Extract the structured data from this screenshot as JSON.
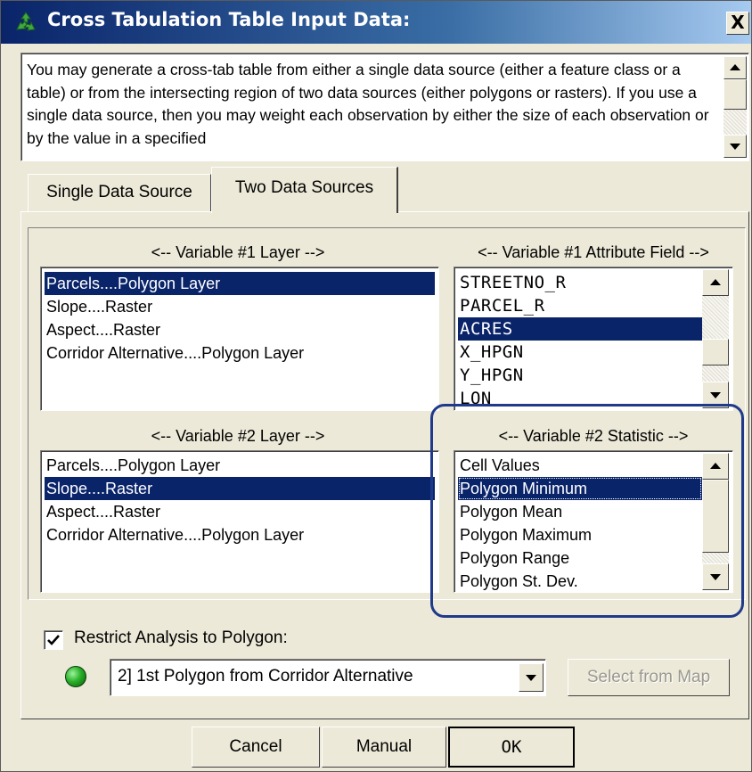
{
  "window": {
    "title": "Cross Tabulation Table Input Data:",
    "close_symbol": "X",
    "title_icon": "recycle-arrows-icon"
  },
  "description": {
    "text": "You may generate a cross-tab table from either a single data source (either a feature class or a table) or from the intersecting region of two data sources (either polygons or rasters).  If you use a single data source, then you may weight each observation by either the size of each observation or by the value in a specified"
  },
  "tabs": [
    {
      "label": "Single Data Source",
      "active": false
    },
    {
      "label": "Two Data Sources",
      "active": true
    }
  ],
  "variable1_layer": {
    "label": "<-- Variable #1 Layer -->",
    "items": [
      "Parcels....Polygon Layer",
      "Slope....Raster",
      "Aspect....Raster",
      "Corridor Alternative....Polygon Layer"
    ],
    "selected": "Parcels....Polygon Layer"
  },
  "variable1_attribute": {
    "label": "<-- Variable #1 Attribute Field -->",
    "items": [
      "STREETNO_R",
      "PARCEL_R",
      "ACRES",
      "X_HPGN",
      "Y_HPGN",
      "LON"
    ],
    "selected": "ACRES"
  },
  "variable2_layer": {
    "label": "<-- Variable #2 Layer -->",
    "items": [
      "Parcels....Polygon Layer",
      "Slope....Raster",
      "Aspect....Raster",
      "Corridor Alternative....Polygon Layer"
    ],
    "selected": "Slope....Raster"
  },
  "variable2_statistic": {
    "label": "<-- Variable #2 Statistic -->",
    "items": [
      "Cell Values",
      "Polygon Minimum",
      "Polygon Mean",
      "Polygon Maximum",
      "Polygon Range",
      "Polygon St. Dev."
    ],
    "selected": "Polygon Minimum"
  },
  "restrict": {
    "label": "Restrict Analysis to Polygon:",
    "checked": true,
    "status_color": "#28b028"
  },
  "polygon_select": {
    "value": "2] 1st Polygon from Corridor Alternative"
  },
  "buttons": {
    "select_from_map": "Select from Map",
    "cancel": "Cancel",
    "manual": "Manual",
    "ok": "OK"
  },
  "colors": {
    "selection": "#0a246a",
    "dialog_bg": "#ece9d8",
    "highlight_ring": "#1f3a8a"
  }
}
